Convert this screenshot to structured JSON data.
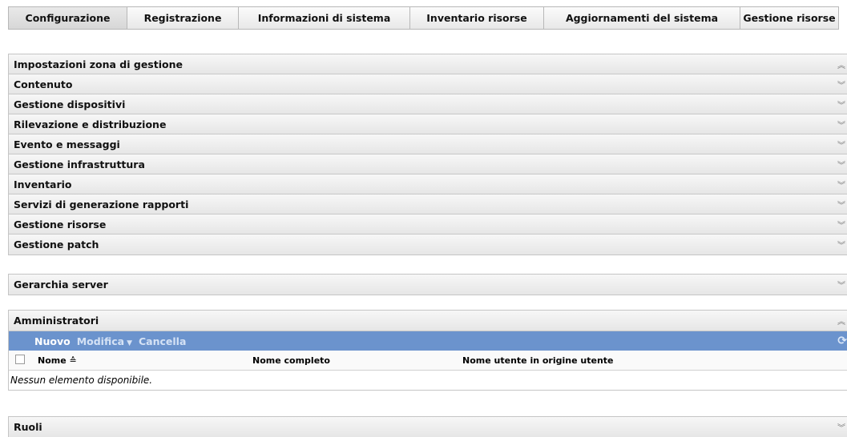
{
  "tabs": [
    {
      "label": "Configurazione",
      "active": true
    },
    {
      "label": "Registrazione",
      "active": false
    },
    {
      "label": "Informazioni di sistema",
      "active": false
    },
    {
      "label": "Inventario risorse",
      "active": false
    },
    {
      "label": "Aggiornamenti del sistema",
      "active": false
    },
    {
      "label": "Gestione risorse",
      "active": false
    }
  ],
  "zone_settings": {
    "items": [
      "Impostazioni zona di gestione",
      "Contenuto",
      "Gestione dispositivi",
      "Rilevazione e distribuzione",
      "Evento e messaggi",
      "Gestione infrastruttura",
      "Inventario",
      "Servizi di generazione rapporti",
      "Gestione risorse",
      "Gestione patch"
    ]
  },
  "server_hierarchy": {
    "title": "Gerarchia server"
  },
  "administrators": {
    "title": "Amministratori",
    "toolbar": {
      "new_label": "Nuovo",
      "edit_label": "Modifica",
      "delete_label": "Cancella"
    },
    "columns": [
      "Nome",
      "Nome completo",
      "Nome utente in origine utente"
    ],
    "empty_message": "Nessun elemento disponibile."
  },
  "roles": {
    "title": "Ruoli"
  }
}
